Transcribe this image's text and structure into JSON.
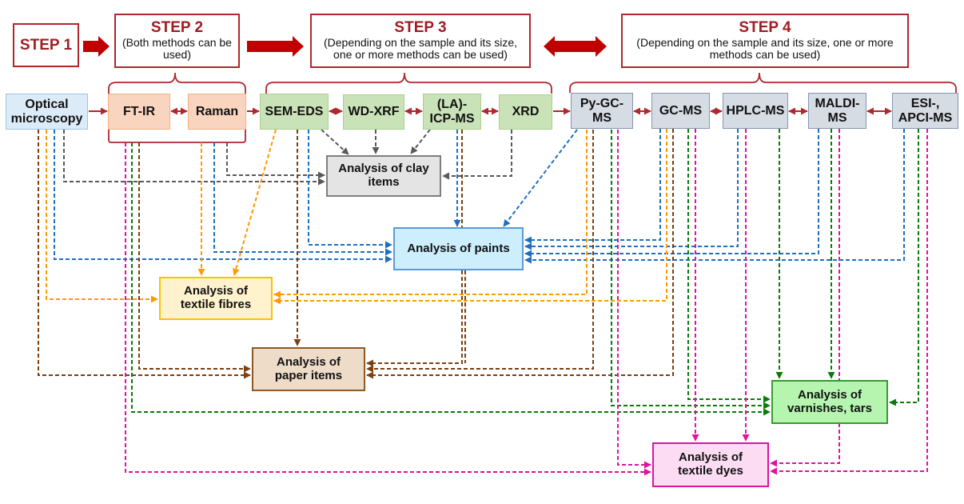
{
  "steps": {
    "step1": {
      "title": "STEP 1"
    },
    "step2": {
      "title": "STEP 2",
      "note": "(Both methods can be used)"
    },
    "step3": {
      "title": "STEP 3",
      "note": "(Depending on the sample and its size, one or more methods can be used)"
    },
    "step4": {
      "title": "STEP 4",
      "note": "(Depending on the sample and its size, one or more methods can be used)"
    }
  },
  "methods": {
    "optical": "Optical microscopy",
    "ftir": "FT-IR",
    "raman": "Raman",
    "semeds": "SEM-EDS",
    "wdxrf": "WD-XRF",
    "icpms": "(LA)-ICP-MS",
    "xrd": "XRD",
    "pygcms": "Py-GC-MS",
    "gcms": "GC-MS",
    "hplcms": "HPLC-MS",
    "maldims": "MALDI-MS",
    "esims": "ESI-, APCI-MS"
  },
  "analyses": {
    "clay": "Analysis of clay items",
    "paints": "Analysis of paints",
    "fibres": "Analysis of textile fibres",
    "paper": "Analysis of paper items",
    "varnishes": "Analysis of varnishes, tars",
    "dyes": "Analysis of textile dyes"
  },
  "colors": {
    "step_accent": "#b0272d",
    "clay_link": "#595959",
    "paints_link": "#1f6fc0",
    "fibres_link": "#ff9a00",
    "paper_link": "#7b3f10",
    "varnishes_link": "#0a7a0a",
    "dyes_link": "#e0139d"
  }
}
